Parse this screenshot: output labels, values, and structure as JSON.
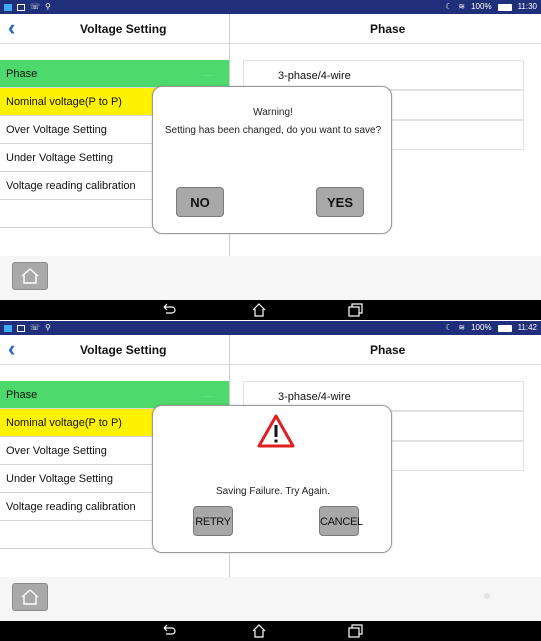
{
  "screens": [
    {
      "status": {
        "time": "11:30",
        "battery": "100%"
      },
      "header": {
        "title": "Voltage Setting",
        "right_title": "Phase"
      },
      "menu": [
        {
          "label": "Phase",
          "tag": "...."
        },
        {
          "label": "Nominal voltage(P to P)"
        },
        {
          "label": "Over Voltage Setting"
        },
        {
          "label": "Under Voltage Setting"
        },
        {
          "label": "Voltage reading calibration"
        }
      ],
      "options": [
        "3-phase/4-wire"
      ],
      "dialog": {
        "title": "Warning!",
        "message": "Setting has been changed, do you want to save?",
        "no_label": "NO",
        "yes_label": "YES"
      }
    },
    {
      "status": {
        "time": "11:42",
        "battery": "100%"
      },
      "header": {
        "title": "Voltage Setting",
        "right_title": "Phase"
      },
      "menu": [
        {
          "label": "Phase",
          "tag": "...."
        },
        {
          "label": "Nominal voltage(P to P)"
        },
        {
          "label": "Over Voltage Setting"
        },
        {
          "label": "Under Voltage Setting"
        },
        {
          "label": "Voltage reading calibration"
        }
      ],
      "options": [
        "3-phase/4-wire"
      ],
      "dialog": {
        "message": "Saving Failure. Try Again.",
        "retry_label": "RETRY",
        "cancel_label": "CANCEL"
      }
    }
  ],
  "colors": {
    "status_bar": "#1f2f7a",
    "selected_item": "#4dd96b",
    "highlight_item": "#fff200",
    "back_arrow": "#1e63c9",
    "button_gray": "#a8a8a8",
    "warning_red": "#e02020"
  }
}
